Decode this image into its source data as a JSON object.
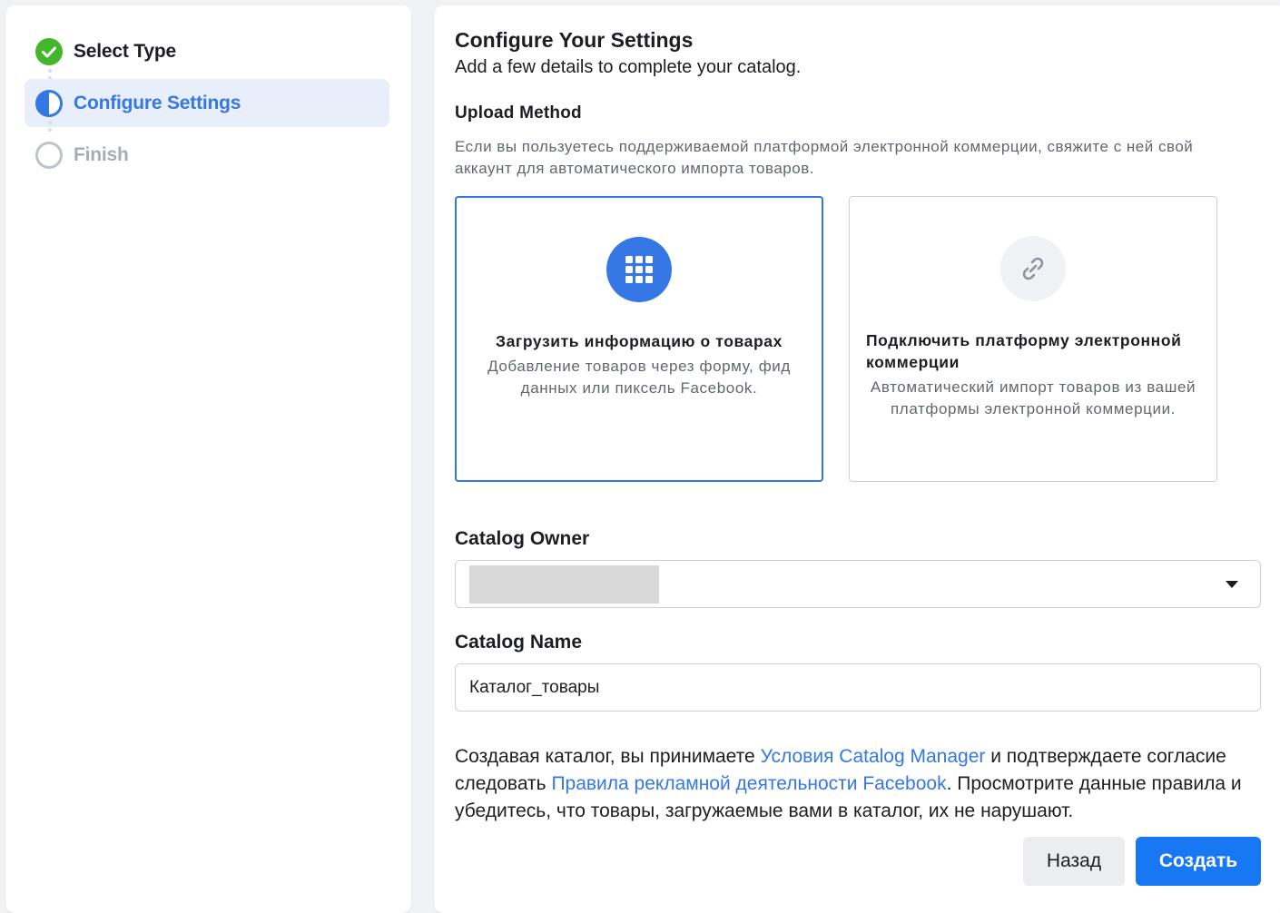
{
  "steps": [
    {
      "label": "Select Type",
      "state": "done",
      "icon": "check-circle-icon"
    },
    {
      "label": "Configure Settings",
      "state": "active",
      "icon": "half-circle-icon"
    },
    {
      "label": "Finish",
      "state": "pending",
      "icon": "empty-circle-icon"
    }
  ],
  "main": {
    "title": "Configure Your Settings",
    "subtitle": "Add a few details to complete your catalog.",
    "upload_method": {
      "label": "Upload Method",
      "description": "Если вы пользуетесь поддерживаемой платформой электронной коммерции, свяжите с ней свой аккаунт для автоматического импорта товаров.",
      "options": [
        {
          "title": "Загрузить информацию о товарах",
          "description": "Добавление товаров через форму, фид данных или пиксель Facebook.",
          "icon": "grid-icon",
          "selected": true
        },
        {
          "title": "Подключить платформу электронной коммерции",
          "description": "Автоматический импорт товаров из вашей платформы электронной коммерции.",
          "icon": "link-icon",
          "selected": false
        }
      ]
    },
    "catalog_owner": {
      "label": "Catalog Owner",
      "value": ""
    },
    "catalog_name": {
      "label": "Catalog Name",
      "value": "Каталог_товары"
    },
    "terms": {
      "part1": "Создавая каталог, вы принимаете ",
      "link1": "Условия Catalog Manager",
      "part2": " и подтверждаете согласие следовать ",
      "link2": "Правила рекламной деятельности Facebook",
      "part3": ". Просмотрите данные правила и убедитесь, что товары, загружаемые вами в каталог, их не нарушают."
    },
    "buttons": {
      "back": "Назад",
      "create": "Создать"
    }
  },
  "colors": {
    "accent": "#3578e5",
    "primary_button": "#1877f2",
    "success": "#42b72a",
    "pending": "#bec3c9"
  }
}
